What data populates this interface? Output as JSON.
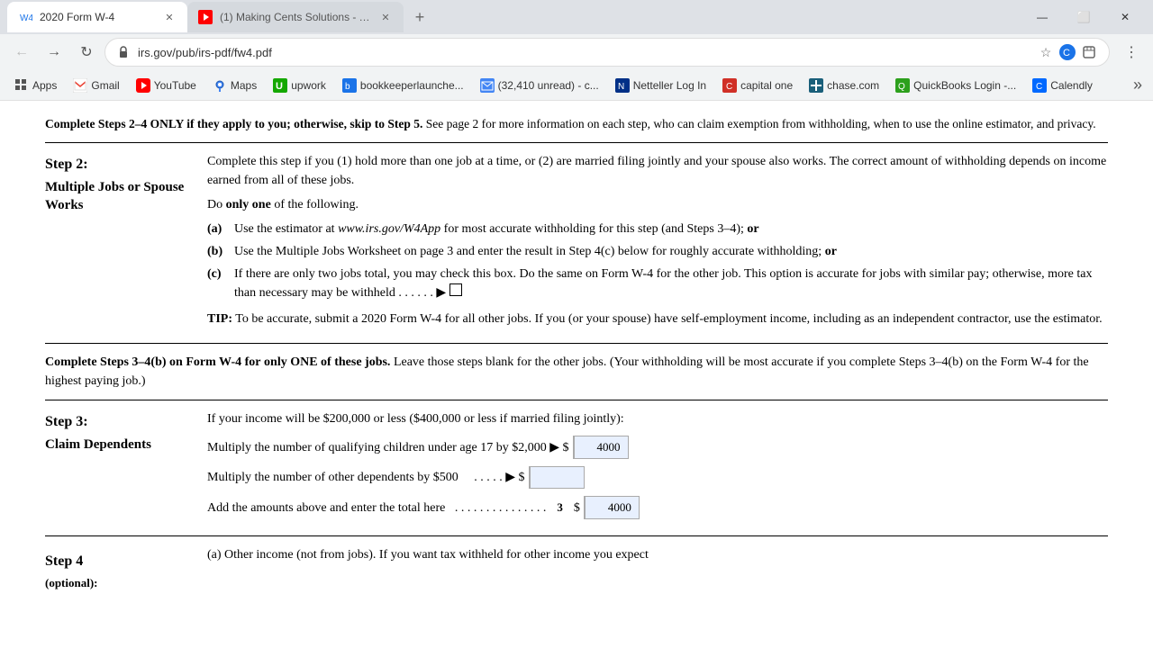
{
  "browser": {
    "tabs": [
      {
        "id": "tab1",
        "favicon": "📄",
        "label": "2020 Form W-4",
        "active": true,
        "favicon_color": "#1a73e8"
      },
      {
        "id": "tab2",
        "favicon": "▶",
        "label": "(1) Making Cents Solutions - You...",
        "active": false,
        "favicon_color": "#ff0000"
      }
    ],
    "new_tab_label": "+",
    "window_controls": [
      "—",
      "⬜",
      "✕"
    ],
    "address": "irs.gov/pub/irs-pdf/fw4.pdf",
    "address_full": "https://irs.gov/pub/irs-pdf/fw4.pdf"
  },
  "bookmarks": [
    {
      "id": "apps",
      "icon": "⬛",
      "label": "Apps"
    },
    {
      "id": "gmail",
      "icon": "M",
      "label": "Gmail"
    },
    {
      "id": "youtube",
      "icon": "▶",
      "label": "YouTube"
    },
    {
      "id": "maps",
      "icon": "📍",
      "label": "Maps"
    },
    {
      "id": "upwork",
      "icon": "U",
      "label": "upwork"
    },
    {
      "id": "bookkeeper",
      "icon": "B",
      "label": "bookkeeperlaunche..."
    },
    {
      "id": "email",
      "icon": "✉",
      "label": "(32,410 unread) - c..."
    },
    {
      "id": "netteller",
      "icon": "N",
      "label": "Netteller Log In"
    },
    {
      "id": "capitalone",
      "icon": "C",
      "label": "capital one"
    },
    {
      "id": "chase",
      "icon": "J",
      "label": "chase.com"
    },
    {
      "id": "quickbooks",
      "icon": "Q",
      "label": "QuickBooks Login -..."
    },
    {
      "id": "calendly",
      "icon": "C",
      "label": "Calendly"
    }
  ],
  "page": {
    "top_note": {
      "bold_part": "Complete Steps 2–4 ONLY if they apply to you; otherwise, skip to Step 5.",
      "normal_part": " See page 2 for more information on each step, who can claim exemption from withholding, when to use the online estimator, and privacy."
    },
    "step2": {
      "number": "Step 2:",
      "title": "Multiple Jobs or Spouse Works",
      "intro": "Complete this step if you (1) hold more than one job at a time, or (2) are married filing jointly and your spouse also works. The correct amount of withholding depends on income earned from all of these jobs.",
      "do_only_one": "Do ",
      "do_only_one_bold": "only one",
      "do_only_one_rest": " of the following.",
      "items": [
        {
          "label": "(a)",
          "text_before": "Use the estimator at ",
          "link": "www.irs.gov/W4App",
          "text_after": " for most accurate withholding for this step (and Steps 3–4); ",
          "bold_end": "or"
        },
        {
          "label": "(b)",
          "text": "Use the Multiple Jobs Worksheet on page 3 and enter the result in Step 4(c) below for roughly accurate withholding; ",
          "bold_end": "or"
        },
        {
          "label": "(c)",
          "text": "If there are only two jobs total, you may check this box. Do the same on Form W-4 for the other job. This option is accurate for jobs with similar pay; otherwise, more tax than necessary may be withheld . . . . . . ▶",
          "has_checkbox": true
        }
      ],
      "tip": {
        "bold": "TIP:",
        "text": " To be accurate, submit a 2020 Form W-4 for all other jobs. If you (or your spouse) have self-employment income, including as an independent contractor, use the estimator."
      }
    },
    "complete_note": "Complete Steps 3–4(b) on Form W-4 for only ONE of these jobs.",
    "complete_note_bold": "Complete Steps 3–4(b) on Form W-4 for ",
    "complete_note_bold2": "only ONE of these jobs.",
    "complete_note_rest": " Leave those steps blank for the other jobs. (Your withholding will be most accurate if you complete Steps 3–4(b) on the Form W-4 for the highest paying job.)",
    "step3": {
      "number": "Step 3:",
      "title": "Claim Dependents",
      "intro": "If your income will be $200,000 or less ($400,000 or less if married filing jointly):",
      "rows": [
        {
          "text": "Multiply the number of qualifying children under age 17 by $2,000 ▶ $",
          "value": "4000",
          "has_input": true
        },
        {
          "text": "Multiply the number of other dependents by $500",
          "dots": ". . . . . ▶ $",
          "has_input": true,
          "value": ""
        },
        {
          "text": "Add the amounts above and enter the total here",
          "dots": ". . . . . . . . . . . . . . .",
          "step_num": "3",
          "value": "4000",
          "has_dollar": true
        }
      ]
    },
    "step4": {
      "number": "Step 4",
      "title": "(optional):",
      "sub_a": "(a) Other income (not from jobs). If you want tax withheld for other income you expect"
    }
  }
}
